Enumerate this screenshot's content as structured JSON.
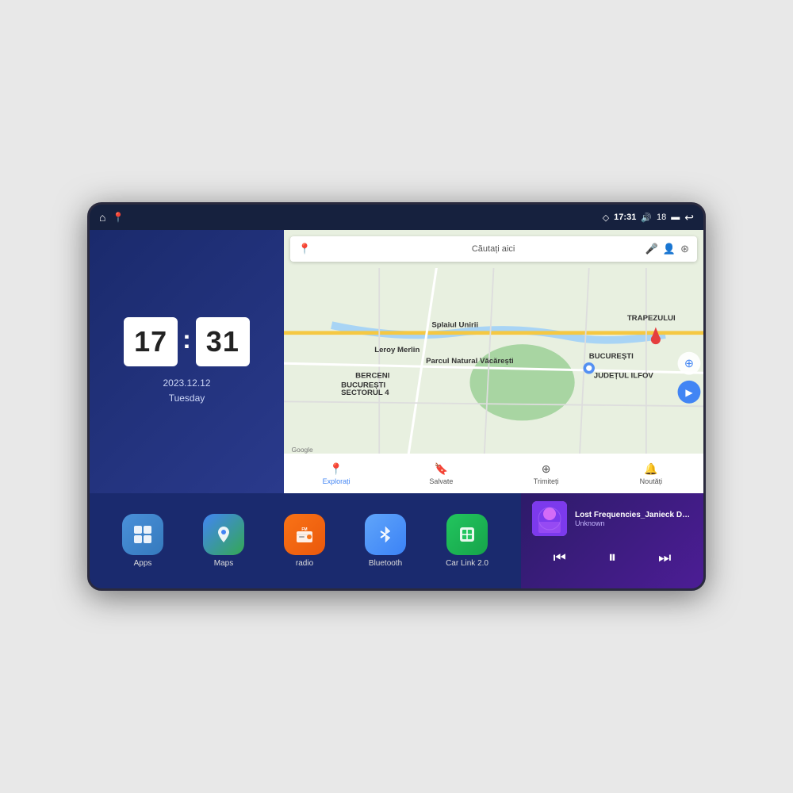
{
  "device": {
    "status_bar": {
      "location_icon": "◇",
      "time": "17:31",
      "volume_icon": "🔊",
      "battery_level": "18",
      "battery_icon": "▬",
      "back_icon": "↩"
    },
    "home_icon": "⌂",
    "pin_icon": "📍"
  },
  "clock": {
    "hours": "17",
    "minutes": "31",
    "date": "2023.12.12",
    "day": "Tuesday"
  },
  "map": {
    "search_placeholder": "Căutați aici",
    "bottom_nav": [
      {
        "label": "Explorați",
        "icon": "📍",
        "active": true
      },
      {
        "label": "Salvate",
        "icon": "🔖",
        "active": false
      },
      {
        "label": "Trimiteți",
        "icon": "⊕",
        "active": false
      },
      {
        "label": "Noutăți",
        "icon": "🔔",
        "active": false
      }
    ],
    "labels": {
      "parcul": "Parcul Natural Văcărești",
      "leroy": "Leroy Merlin",
      "berceni": "BERCENI",
      "bucuresti": "BUCUREȘTI",
      "ilfov": "JUDEȚUL ILFOV",
      "trapezului": "TRAPEZULUI",
      "splaiul": "Splaiul Unirii",
      "sector4": "BUCUREȘTI\nSECTORUL 4"
    }
  },
  "apps": [
    {
      "id": "apps",
      "label": "Apps",
      "icon": "⊞",
      "icon_class": "icon-apps"
    },
    {
      "id": "maps",
      "label": "Maps",
      "icon": "🗺",
      "icon_class": "icon-maps"
    },
    {
      "id": "radio",
      "label": "radio",
      "icon": "📻",
      "icon_class": "icon-radio"
    },
    {
      "id": "bluetooth",
      "label": "Bluetooth",
      "icon": "⊕",
      "icon_class": "icon-bluetooth"
    },
    {
      "id": "carlink",
      "label": "Car Link 2.0",
      "icon": "📱",
      "icon_class": "icon-carlink"
    }
  ],
  "music": {
    "title": "Lost Frequencies_Janieck Devy-...",
    "artist": "Unknown",
    "prev_icon": "⏮",
    "play_icon": "⏸",
    "next_icon": "⏭"
  }
}
